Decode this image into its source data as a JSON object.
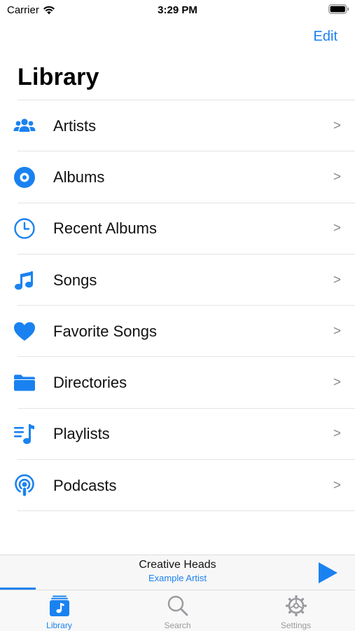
{
  "status_bar": {
    "carrier": "Carrier",
    "time": "3:29 PM"
  },
  "nav": {
    "edit_label": "Edit",
    "title": "Library"
  },
  "colors": {
    "accent": "#1a82f0",
    "separator": "#e3e3e6",
    "chevron": "#8a8a8f"
  },
  "library": {
    "items": [
      {
        "label": "Artists",
        "icon": "artists-icon",
        "chevron": ">"
      },
      {
        "label": "Albums",
        "icon": "album-icon",
        "chevron": ">"
      },
      {
        "label": "Recent Albums",
        "icon": "clock-icon",
        "chevron": ">"
      },
      {
        "label": "Songs",
        "icon": "music-note-icon",
        "chevron": ">"
      },
      {
        "label": "Favorite Songs",
        "icon": "heart-icon",
        "chevron": ">"
      },
      {
        "label": "Directories",
        "icon": "folder-icon",
        "chevron": ">"
      },
      {
        "label": "Playlists",
        "icon": "playlist-icon",
        "chevron": ">"
      },
      {
        "label": "Podcasts",
        "icon": "podcast-icon",
        "chevron": ">"
      }
    ]
  },
  "player": {
    "title": "Creative Heads",
    "artist": "Example Artist",
    "progress": 0.1
  },
  "tabs": [
    {
      "label": "Library",
      "icon": "library-tab-icon",
      "active": true
    },
    {
      "label": "Search",
      "icon": "search-icon",
      "active": false
    },
    {
      "label": "Settings",
      "icon": "gear-icon",
      "active": false
    }
  ]
}
